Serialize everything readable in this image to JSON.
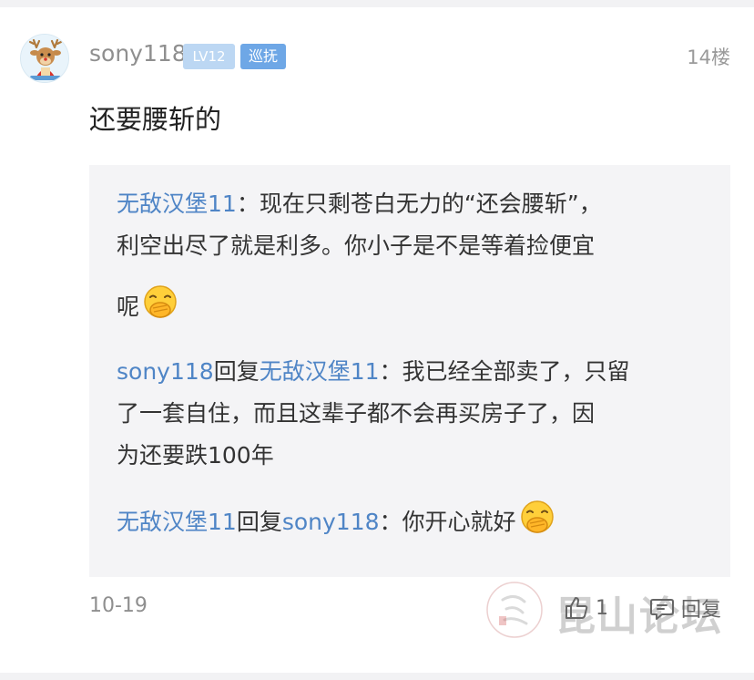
{
  "post": {
    "username": "sony118",
    "level_badge": "LV12",
    "role_badge": "巡抚",
    "floor": "14楼",
    "content": "还要腰斩的",
    "date": "10-19",
    "like_count": "1",
    "reply_label": "回复"
  },
  "quote_replies": [
    {
      "author": "无敌汉堡11",
      "sep": "：",
      "lines": [
        "现在只剩苍白无力的“还会腰斩”，",
        "利空出尽了就是利多。你小子是不是等着捡便宜",
        "呢"
      ],
      "emoji": "laughing-cover-mouth-emoji"
    },
    {
      "author": "sony118",
      "reply_word": "回复",
      "target": "无敌汉堡11",
      "sep": "：",
      "lines": [
        "我已经全部卖了，只留",
        "了一套自住，而且这辈子都不会再买房子了，因",
        "为还要跌100年"
      ]
    },
    {
      "author": "无敌汉堡11",
      "reply_word": "回复",
      "target": "sony118",
      "sep": "：",
      "lines": [
        "你开心就好"
      ],
      "emoji": "laughing-cover-mouth-emoji"
    }
  ],
  "watermark": {
    "text": "昆山论坛"
  },
  "colors": {
    "username_link": "#4f85c6",
    "level_badge_bg": "#bcd7f3",
    "role_badge_bg": "#6ea7e6",
    "quote_bg": "#f4f4f6"
  }
}
